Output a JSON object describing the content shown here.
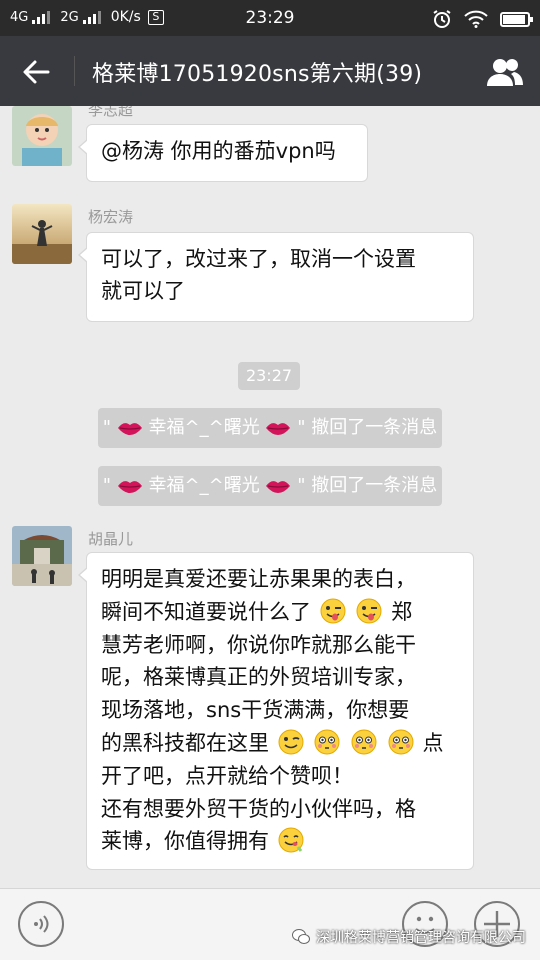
{
  "status_bar": {
    "net1": "4G",
    "net2": "2G",
    "speed": "0K/s",
    "s_icon": "S",
    "time": "23:29"
  },
  "header": {
    "title": "格莱博17051920sns第六期(39)"
  },
  "messages": [
    {
      "sender": "李志超",
      "text": "@杨涛 你用的番茄vpn吗"
    },
    {
      "sender": "杨宏涛",
      "line1": "可以了，改过来了，取消一个设置",
      "line2": "就可以了"
    },
    {
      "sender": "胡晶儿",
      "l1": "明明是真爱还要让赤果果的表白，",
      "l2a": "瞬间不知道要说什么了",
      "l2b": "郑",
      "l3": "慧芳老师啊，你说你咋就那么能干",
      "l4": "呢，格莱博真正的外贸培训专家，",
      "l5": "现场落地，sns干货满满，你想要",
      "l6a": "的黑科技都在这里",
      "l6b": "点",
      "l7": "开了吧，点开就给个赞呗！",
      "l8": "还有想要外贸干货的小伙伴吗，格",
      "l9": "莱博，你值得拥有"
    }
  ],
  "timestamp": "23:27",
  "recall_notices": [
    {
      "quote_open": "\"",
      "name": "幸福^_^曙光",
      "suffix": "\" 撤回了一条消息"
    },
    {
      "quote_open": "\"",
      "name": "幸福^_^曙光",
      "suffix": "\" 撤回了一条消息"
    }
  ],
  "watermark": "深圳格莱博营销管理咨询有限公司",
  "icons": {
    "back": "back-arrow-icon",
    "members": "group-members-icon",
    "voice": "voice-icon",
    "emoji": "emoji-icon",
    "plus": "plus-icon"
  },
  "colors": {
    "title_bar": "#393a3f",
    "status_bar": "#2b2b2b",
    "chat_bg": "#ebebeb",
    "bubble": "#ffffff",
    "notice": "#cfcfcf"
  }
}
